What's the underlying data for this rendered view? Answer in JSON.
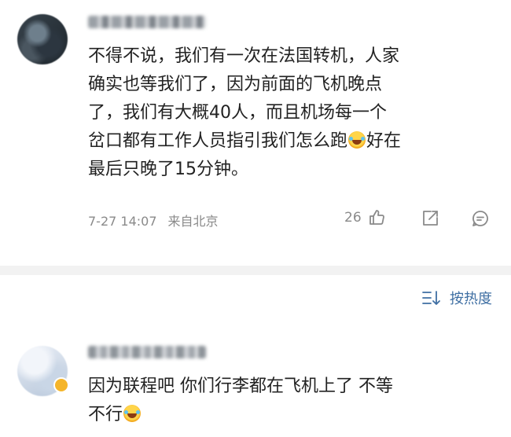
{
  "comments": [
    {
      "username": "",
      "lines": [
        "不得不说，我们有一次在法国转机，人家",
        "确实也等我们了，因为前面的飞机晚点",
        "了，我们有大概40人，而且机场每一个",
        "岔口都有工作人员指引我们怎么跑",
        "好在",
        "最后只晚了15分钟。"
      ],
      "emoji": "laugh-cry-emoji",
      "time": "7-27 14:07",
      "location": "来自北京",
      "likes": "26"
    },
    {
      "username": "",
      "lines": [
        "因为联程吧 你们行李都在飞机上了 不等",
        "不行"
      ],
      "emoji": "laugh-cry-emoji"
    }
  ],
  "sort": {
    "label": "按热度",
    "icon": "sort-icon"
  },
  "icons": {
    "like": "thumbs-up-icon",
    "share": "share-icon",
    "comment": "comment-icon"
  },
  "colors": {
    "link_blue": "#3f6fa3",
    "meta_gray": "#8a8a8a",
    "divider": "#f2f2f2"
  }
}
